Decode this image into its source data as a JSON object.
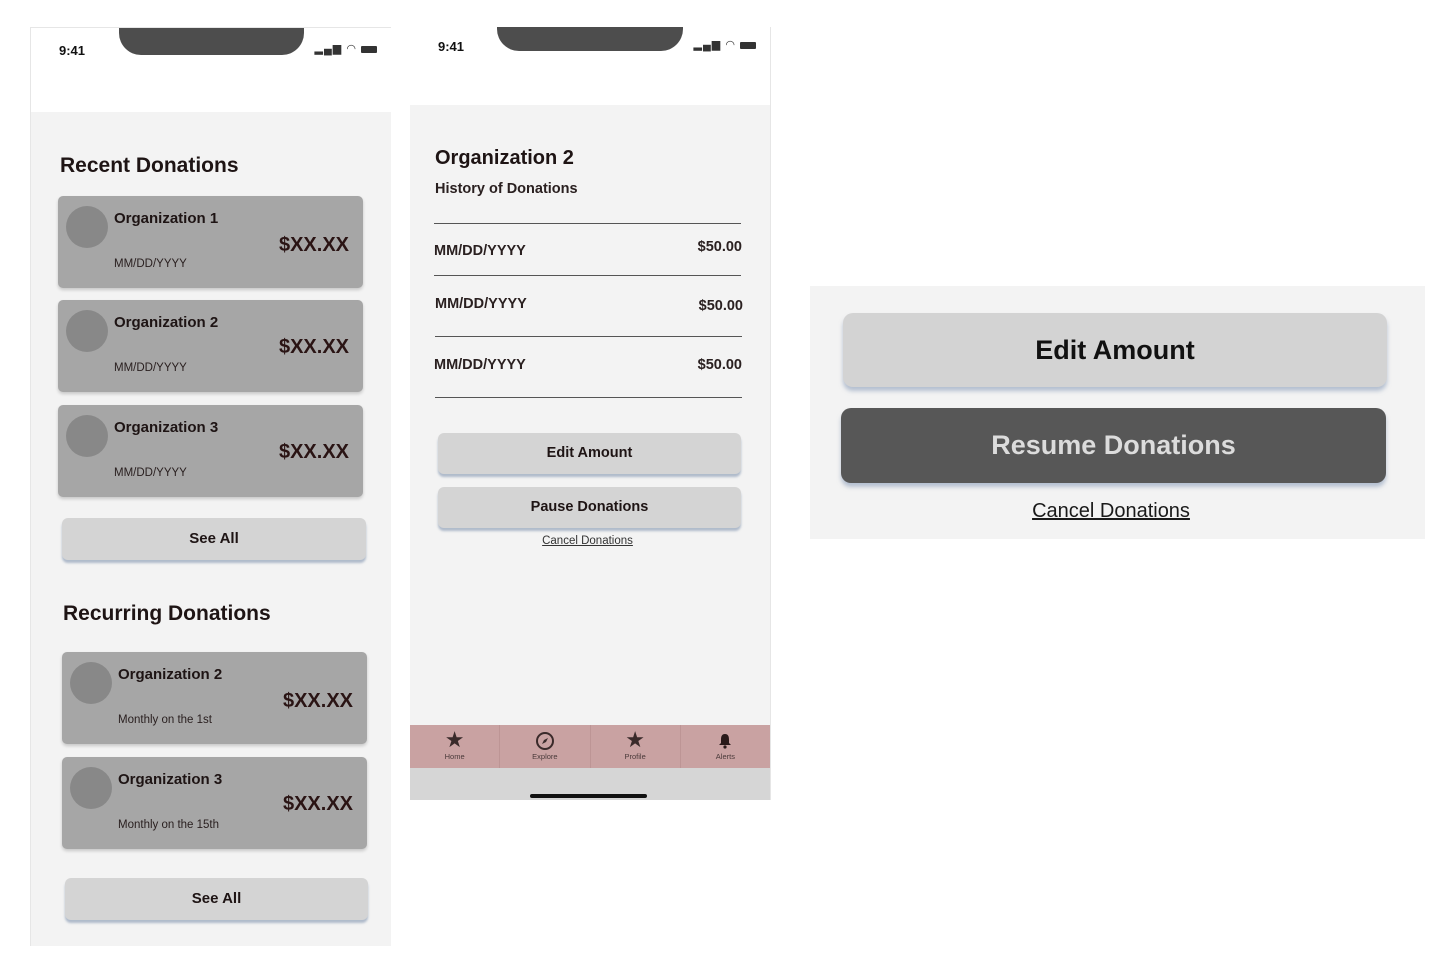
{
  "status_bar": {
    "time": "9:41",
    "signal_icon": "signal-icon",
    "wifi_icon": "wifi-icon",
    "battery_icon": "battery-icon"
  },
  "screen1": {
    "recent_title": "Recent Donations",
    "recent": [
      {
        "org": "Organization 1",
        "date": "MM/DD/YYYY",
        "amount": "$XX.XX"
      },
      {
        "org": "Organization 2",
        "date": "MM/DD/YYYY",
        "amount": "$XX.XX"
      },
      {
        "org": "Organization 3",
        "date": "MM/DD/YYYY",
        "amount": "$XX.XX"
      }
    ],
    "see_all_recent": "See All",
    "recurring_title": "Recurring Donations",
    "recurring": [
      {
        "org": "Organization 2",
        "schedule": "Monthly on the 1st",
        "amount": "$XX.XX"
      },
      {
        "org": "Organization 3",
        "schedule": "Monthly on the 15th",
        "amount": "$XX.XX"
      }
    ],
    "see_all_recurring": "See All"
  },
  "screen2": {
    "title": "Organization 2",
    "subtitle": "History of Donations",
    "history": [
      {
        "date": "MM/DD/YYYY",
        "amount": "$50.00"
      },
      {
        "date": "MM/DD/YYYY",
        "amount": "$50.00"
      },
      {
        "date": "MM/DD/YYYY",
        "amount": "$50.00"
      }
    ],
    "edit_label": "Edit Amount",
    "pause_label": "Pause Donations",
    "cancel_label": "Cancel Donations",
    "tabs": [
      {
        "label": "Home",
        "icon": "star-icon"
      },
      {
        "label": "Explore",
        "icon": "compass-icon"
      },
      {
        "label": "Profile",
        "icon": "star-icon"
      },
      {
        "label": "Alerts",
        "icon": "bell-icon"
      }
    ]
  },
  "panel3": {
    "edit_label": "Edit Amount",
    "resume_label": "Resume Donations",
    "cancel_label": "Cancel Donations"
  },
  "colors": {
    "card": "#a6a6a6",
    "tabbar": "#c9a2a2",
    "dark_button": "#575757",
    "light_button": "#d4d4d4"
  }
}
